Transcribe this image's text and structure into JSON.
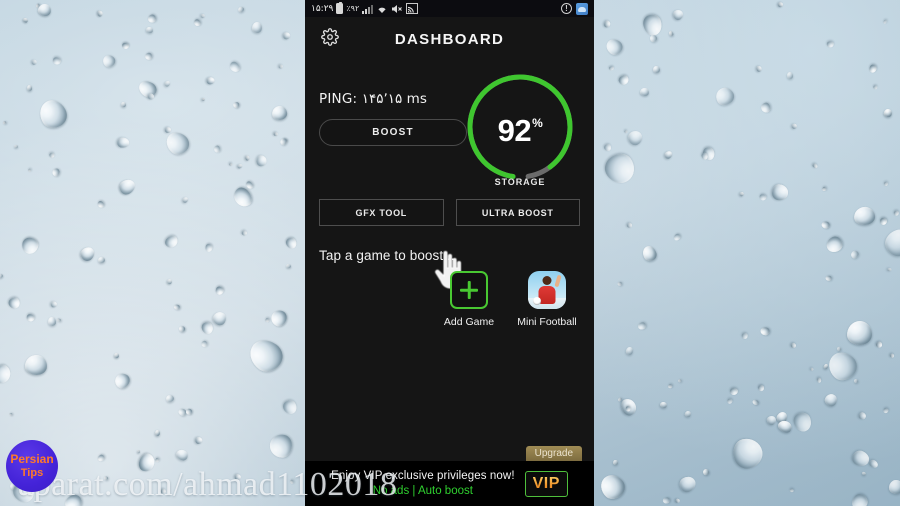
{
  "statusbar": {
    "clock": "۱۵:۲۹",
    "battery_percent": "٪۹۲",
    "icons": [
      "battery-icon",
      "signal-bars-icon",
      "wifi-icon",
      "mute-icon",
      "cast-icon"
    ],
    "right_icons": [
      "info-circle-icon",
      "app-notification-icon"
    ]
  },
  "header": {
    "title": "DASHBOARD",
    "settings_icon": "gear-icon"
  },
  "stats": {
    "ping_label": "PING: ۱۴۵٬۱۵ ms",
    "boost_label": "BOOST",
    "gauge": {
      "value": "92",
      "percent_symbol": "%",
      "label": "STORAGE",
      "fill_percent": 92,
      "fill_color": "#3fc62f",
      "track_color": "#6b6b6b"
    }
  },
  "actions": {
    "gfx_tool_label": "GFX TOOL",
    "ultra_boost_label": "ULTRA BOOST"
  },
  "games": {
    "hint": "Tap a game to boost...",
    "items": [
      {
        "label": "Add Game",
        "icon": "plus-icon"
      },
      {
        "label": "Mini Football",
        "icon": "mini-football-app-icon"
      }
    ]
  },
  "vip": {
    "upgrade_label": "Upgrade",
    "line1": "Enjoy VIP exclusive privileges now!",
    "line2": "No ads | Auto boost",
    "badge_label": "VIP",
    "accent_green": "#2fd02f",
    "badge_gold": "#f0952c"
  },
  "watermark": {
    "url_text": "aparat.com/ahmad1102018",
    "logo_line1": "Persian",
    "logo_line2": "Tips"
  }
}
